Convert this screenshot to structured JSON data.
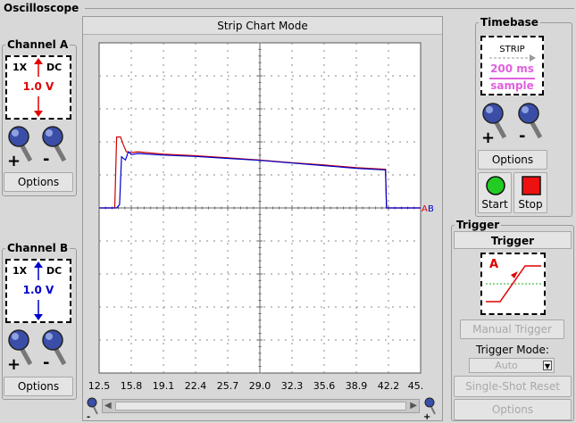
{
  "window": {
    "title": "Oscilloscope"
  },
  "scope": {
    "mode_title": "Strip Chart Mode",
    "x_ticks": [
      "12.5",
      "15.8",
      "19.1",
      "22.4",
      "25.7",
      "29.0",
      "32.3",
      "35.6",
      "38.9",
      "42.2",
      "45."
    ],
    "marker_a": "A",
    "marker_b": "B"
  },
  "channel_a": {
    "title": "Channel A",
    "probe": "1X",
    "coupling": "DC",
    "volts": "1.0 V",
    "options": "Options",
    "color": "#e00000"
  },
  "channel_b": {
    "title": "Channel B",
    "probe": "1X",
    "coupling": "DC",
    "volts": "1.0 V",
    "options": "Options",
    "color": "#0000cc"
  },
  "timebase": {
    "title": "Timebase",
    "mode": "STRIP",
    "rate": "200 ms",
    "unit": "sample",
    "options": "Options",
    "start": "Start",
    "stop": "Stop",
    "color": "#e060e0"
  },
  "trigger": {
    "title": "Trigger",
    "header": "Trigger",
    "channel": "A",
    "manual": "Manual Trigger",
    "mode_label": "Trigger Mode:",
    "mode_value": "Auto",
    "single_shot": "Single-Shot Reset",
    "options": "Options"
  },
  "chart_data": {
    "type": "line",
    "xlim": [
      12.5,
      45.5
    ],
    "x_ticks": [
      12.5,
      15.8,
      19.1,
      22.4,
      25.7,
      29.0,
      32.3,
      35.6,
      38.9,
      42.2,
      45.0
    ],
    "series": [
      {
        "name": "A",
        "color": "#cc0000",
        "x": [
          12.5,
          14.1,
          14.3,
          14.7,
          15.0,
          15.3,
          15.8,
          16.5,
          19.1,
          22.4,
          25.7,
          29.0,
          32.3,
          35.6,
          38.9,
          41.9,
          42.0,
          42.2,
          45.5
        ],
        "y": [
          0,
          0,
          2.15,
          2.15,
          1.9,
          1.7,
          1.68,
          1.7,
          1.63,
          1.58,
          1.52,
          1.45,
          1.37,
          1.3,
          1.22,
          1.17,
          0,
          0,
          0
        ]
      },
      {
        "name": "B",
        "color": "#0000cc",
        "x": [
          12.5,
          14.3,
          14.6,
          14.8,
          15.2,
          15.5,
          15.8,
          16.5,
          19.1,
          22.4,
          25.7,
          29.0,
          32.3,
          35.6,
          38.9,
          41.9,
          42.0,
          42.2,
          45.5
        ],
        "y": [
          0,
          0,
          0.1,
          1.55,
          1.45,
          1.7,
          1.62,
          1.65,
          1.6,
          1.56,
          1.5,
          1.44,
          1.36,
          1.28,
          1.2,
          1.15,
          0,
          0,
          0
        ]
      }
    ]
  }
}
